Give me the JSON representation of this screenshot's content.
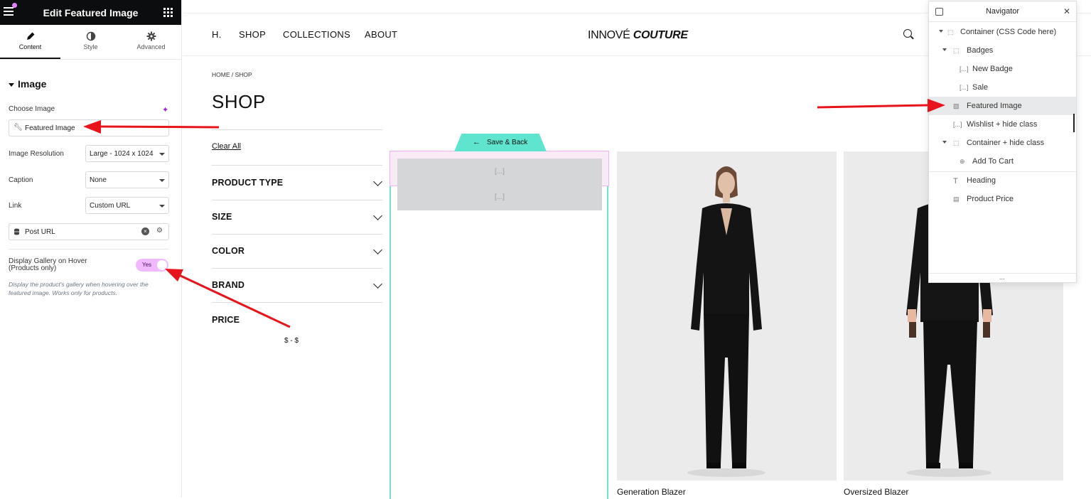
{
  "editor": {
    "title": "Edit Featured Image",
    "tabs": [
      {
        "label": "Content"
      },
      {
        "label": "Style"
      },
      {
        "label": "Advanced"
      }
    ],
    "section_title": "Image",
    "choose_image_label": "Choose Image",
    "choose_image_value": "Featured Image",
    "resolution_label": "Image Resolution",
    "resolution_value": "Large - 1024 x 1024",
    "caption_label": "Caption",
    "caption_value": "None",
    "link_label": "Link",
    "link_value": "Custom URL",
    "post_url_value": "Post URL",
    "gallery_label_1": "Display Gallery on Hover",
    "gallery_label_2": "(Products only)",
    "toggle_text": "Yes",
    "help_text": "Display the product's gallery when hovering over the featured image. Works only for products."
  },
  "site": {
    "nav": [
      "H.",
      "SHOP",
      "COLLECTIONS",
      "ABOUT"
    ],
    "logo_main": "INNOVÉ",
    "logo_italic": "COUTURE",
    "breadcrumb": "HOME / SHOP",
    "page_title": "SHOP",
    "clear_all": "Clear All",
    "filters": [
      "PRODUCT TYPE",
      "SIZE",
      "COLOR",
      "BRAND"
    ],
    "price_label": "PRICE",
    "price_range": "$ - $",
    "save_back": "Save & Back",
    "placeholder_1": "[...]",
    "placeholder_2": "[...]",
    "products": [
      {
        "name": "Generation Blazer"
      },
      {
        "name": "Oversized Blazer"
      }
    ]
  },
  "navigator": {
    "title": "Navigator",
    "items": [
      {
        "label": "Container (CSS Code here)"
      },
      {
        "label": "Badges"
      },
      {
        "label": "New Badge"
      },
      {
        "label": "Sale"
      },
      {
        "label": "Featured Image"
      },
      {
        "label": "Wishlist + hide class"
      },
      {
        "label": "Container + hide class"
      },
      {
        "label": "Add To Cart"
      },
      {
        "label": "Heading"
      },
      {
        "label": "Product Price"
      }
    ],
    "footer_dots": "..."
  },
  "colors": {
    "accent_pink": "#f0b9ff",
    "accent_teal": "#5fe5cf",
    "arrow_red": "#e8141b",
    "header_black": "#0c0d0e"
  }
}
